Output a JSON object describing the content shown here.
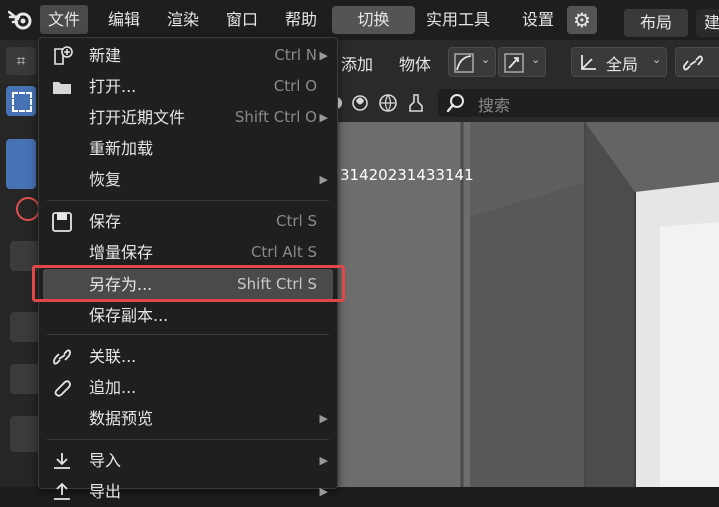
{
  "topbar": {
    "menus": [
      "文件",
      "编辑",
      "渲染",
      "窗口",
      "帮助"
    ],
    "switch_label": "切换",
    "extra_menus": [
      "实用工具",
      "设置"
    ],
    "workspace_tabs": [
      "布局",
      "建"
    ]
  },
  "toolbar": {
    "add_label": "添加",
    "object_label": "物体",
    "transform_label": "全局"
  },
  "header2": {
    "search_placeholder": "搜索"
  },
  "viewport": {
    "overlay_text": "31420231433141"
  },
  "file_menu": {
    "items": [
      {
        "label": "新建",
        "shortcut": "Ctrl N",
        "submenu": true,
        "icon": "new-file-icon"
      },
      {
        "label": "打开...",
        "shortcut": "Ctrl O",
        "submenu": false,
        "icon": "folder-icon"
      },
      {
        "label": "打开近期文件",
        "shortcut": "Shift Ctrl O",
        "submenu": true,
        "icon": ""
      },
      {
        "label": "重新加载",
        "shortcut": "",
        "submenu": false,
        "icon": ""
      },
      {
        "label": "恢复",
        "shortcut": "",
        "submenu": true,
        "icon": ""
      },
      {
        "label": "保存",
        "shortcut": "Ctrl S",
        "submenu": false,
        "icon": "save-icon"
      },
      {
        "label": "增量保存",
        "shortcut": "Ctrl Alt S",
        "submenu": false,
        "icon": ""
      },
      {
        "label": "另存为...",
        "shortcut": "Shift Ctrl S",
        "submenu": false,
        "icon": "",
        "highlighted": true
      },
      {
        "label": "保存副本...",
        "shortcut": "",
        "submenu": false,
        "icon": ""
      },
      {
        "label": "关联...",
        "shortcut": "",
        "submenu": false,
        "icon": "link-icon"
      },
      {
        "label": "追加...",
        "shortcut": "",
        "submenu": false,
        "icon": "paperclip-icon"
      },
      {
        "label": "数据预览",
        "shortcut": "",
        "submenu": true,
        "icon": ""
      },
      {
        "label": "导入",
        "shortcut": "",
        "submenu": true,
        "icon": "import-icon"
      },
      {
        "label": "导出",
        "shortcut": "",
        "submenu": true,
        "icon": "export-icon"
      }
    ]
  },
  "colors": {
    "highlight_box": "#e04848",
    "menu_bg": "#1f1f1f",
    "highlight_row": "#4a4a4a"
  }
}
